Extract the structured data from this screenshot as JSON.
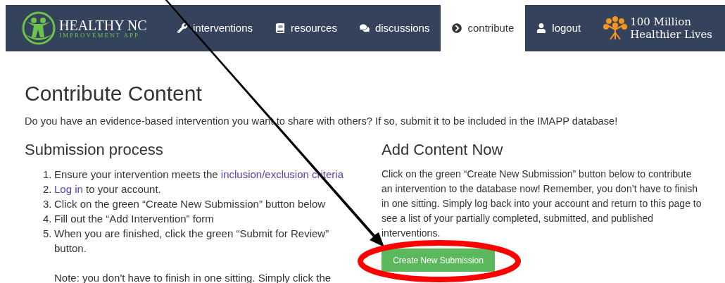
{
  "navbar": {
    "logo": {
      "title": "HEALTHY NC",
      "subtitle": "IMPROVEMENT APP"
    },
    "items": [
      {
        "label": "interventions",
        "selected": false
      },
      {
        "label": "resources",
        "selected": false
      },
      {
        "label": "discussions",
        "selected": false
      },
      {
        "label": "contribute",
        "selected": true
      },
      {
        "label": "logout",
        "selected": false
      }
    ],
    "partner_logo": {
      "line_1": "100 Million",
      "line_2": "Healthier Lives"
    }
  },
  "page": {
    "title": "Contribute Content",
    "intro": "Do you have an evidence-based intervention you want to share with others? If so, submit it to be included in the IMAPP database!",
    "submission_process": {
      "heading": "Submission process",
      "steps": [
        {
          "number": "1.",
          "parts": [
            {
              "text": "Ensure your intervention meets the ",
              "link": false
            },
            {
              "text": "inclusion/exclusion criteria",
              "link": true
            }
          ]
        },
        {
          "number": "2.",
          "parts": [
            {
              "text": "Log in",
              "link": true
            },
            {
              "text": " to your account.",
              "link": false
            }
          ]
        },
        {
          "number": "3.",
          "parts": [
            {
              "text": "Click on the green “Create New Submission” button below",
              "link": false
            }
          ]
        },
        {
          "number": "4.",
          "parts": [
            {
              "text": "Fill out the “Add Intervention” form",
              "link": false
            }
          ]
        },
        {
          "number": "5.",
          "parts": [
            {
              "text": "When you are finished, click the green “Submit for Review” button.",
              "link": false
            }
          ]
        }
      ],
      "note": "Note: you don't have to finish in one sitting. Simply click the"
    },
    "add_content": {
      "heading": "Add Content Now",
      "text": "Click on the green “Create New Submission” button below to contribute an intervention to the database now! Remember, you don’t have to finish in one sitting. Simply log back into your account and return to this page to see a list of your partially completed, submitted, and published interventions.",
      "button": "Create New Submission"
    }
  }
}
